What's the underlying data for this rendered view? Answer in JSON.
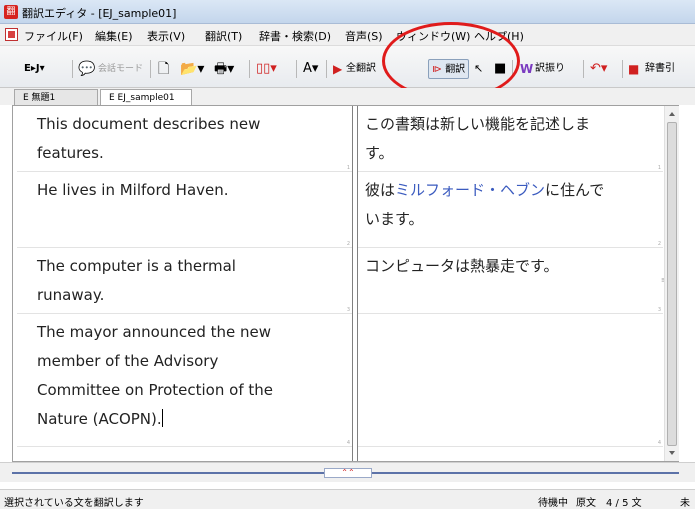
{
  "window": {
    "title": "翻訳エディタ - [EJ_sample01]",
    "app_icon": "翻"
  },
  "menu": {
    "items": [
      "ファイル(F)",
      "編集(E)",
      "表示(V)",
      "翻訳(T)",
      "辞書・検索(D)",
      "音声(S)",
      "ウィンドウ(W)",
      "ヘルプ(H)"
    ]
  },
  "toolbar": {
    "direction": "E▸J▾",
    "conversation_mode": "会話モード",
    "translate_all": "全翻訳",
    "translate": "翻訳",
    "parallel": "訳振り",
    "dictionary": "辞書引"
  },
  "tabs": [
    {
      "label": "E  無題1"
    },
    {
      "label": "E  EJ_sample01"
    }
  ],
  "segments": [
    {
      "source": [
        "This document describes new",
        "features."
      ],
      "target": [
        "この書類は新しい機能を記述しま",
        "す。"
      ],
      "num": "1"
    },
    {
      "source": [
        "He lives in Milford Haven."
      ],
      "target_pre": "彼は",
      "target_link": "ミルフォード・ヘブン",
      "target_post": "に住んで",
      "target_line2": "います。",
      "num": "2"
    },
    {
      "source": [
        "The computer is a thermal",
        "runaway."
      ],
      "target": [
        "コンピュータは熱暴走です。"
      ],
      "num": "3"
    },
    {
      "source": [
        "The mayor announced the new",
        "member of the Advisory",
        "Committee on Protection of the",
        "Nature (ACOPN)."
      ],
      "target": [],
      "num": "4"
    }
  ],
  "statusbar": {
    "message": "選択されている文を翻訳します",
    "state": "待機中",
    "mode": "原文",
    "position": "4 / 5 文",
    "extra": "未"
  }
}
